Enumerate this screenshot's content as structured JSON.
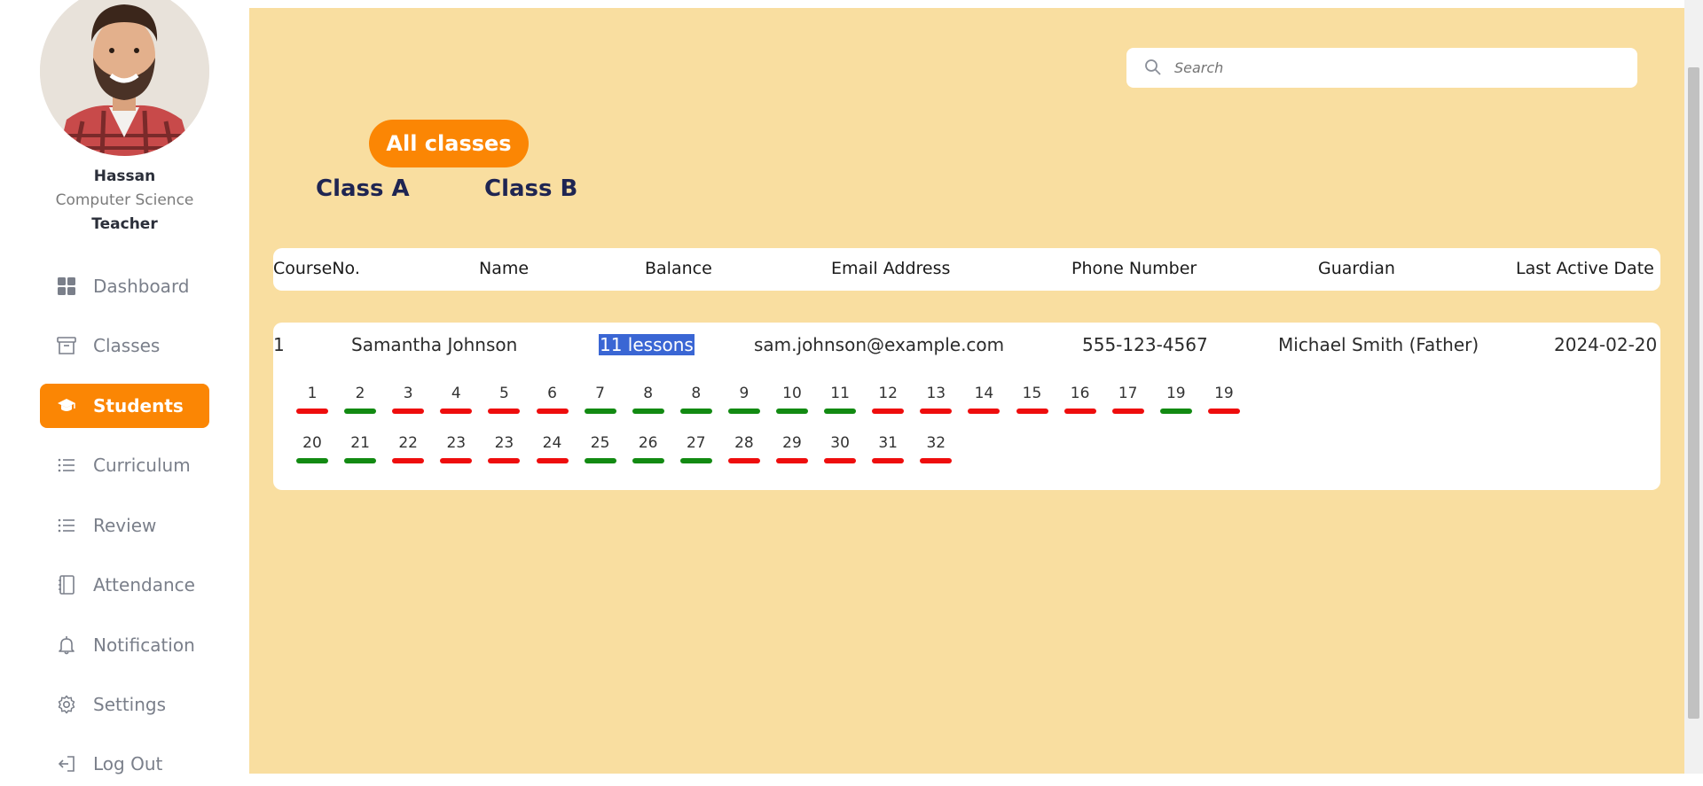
{
  "profile": {
    "name": "Hassan",
    "department": "Computer Science",
    "role": "Teacher"
  },
  "nav": [
    {
      "label": "Dashboard",
      "icon": "dashboard-icon",
      "active": false
    },
    {
      "label": "Classes",
      "icon": "archive-icon",
      "active": false
    },
    {
      "label": "Students",
      "icon": "graduation-cap-icon",
      "active": true
    },
    {
      "label": "Curriculum",
      "icon": "list-icon",
      "active": false
    },
    {
      "label": "Review",
      "icon": "list-icon",
      "active": false
    },
    {
      "label": "Attendance",
      "icon": "notebook-icon",
      "active": false
    },
    {
      "label": "Notification",
      "icon": "bell-icon",
      "active": false
    },
    {
      "label": "Settings",
      "icon": "gear-icon",
      "active": false
    },
    {
      "label": "Log Out",
      "icon": "logout-icon",
      "active": false
    }
  ],
  "search": {
    "placeholder": "Search"
  },
  "filters": {
    "all": "All classes",
    "class_a": "Class A",
    "class_b": "Class B"
  },
  "table": {
    "headers": [
      "CourseNo.",
      "Name",
      "Balance",
      "Email Address",
      "Phone Number",
      "Guardian",
      "Last Active Date"
    ],
    "row": {
      "course_no": "1",
      "name": "Samantha Johnson",
      "balance": "11 lessons",
      "email": "sam.johnson@example.com",
      "phone": "555-123-4567",
      "guardian": "Michael Smith (Father)",
      "last_active": "2024-02-20"
    },
    "lessons": [
      {
        "n": "1",
        "status": "absent"
      },
      {
        "n": "2",
        "status": "present"
      },
      {
        "n": "3",
        "status": "absent"
      },
      {
        "n": "4",
        "status": "absent"
      },
      {
        "n": "5",
        "status": "absent"
      },
      {
        "n": "6",
        "status": "absent"
      },
      {
        "n": "7",
        "status": "present"
      },
      {
        "n": "8",
        "status": "present"
      },
      {
        "n": "8",
        "status": "present"
      },
      {
        "n": "9",
        "status": "present"
      },
      {
        "n": "10",
        "status": "present"
      },
      {
        "n": "11",
        "status": "present"
      },
      {
        "n": "12",
        "status": "absent"
      },
      {
        "n": "13",
        "status": "absent"
      },
      {
        "n": "14",
        "status": "absent"
      },
      {
        "n": "15",
        "status": "absent"
      },
      {
        "n": "16",
        "status": "absent"
      },
      {
        "n": "17",
        "status": "absent"
      },
      {
        "n": "19",
        "status": "present"
      },
      {
        "n": "19",
        "status": "absent"
      },
      {
        "n": "20",
        "status": "present"
      },
      {
        "n": "21",
        "status": "present"
      },
      {
        "n": "22",
        "status": "absent"
      },
      {
        "n": "23",
        "status": "absent"
      },
      {
        "n": "23",
        "status": "absent"
      },
      {
        "n": "24",
        "status": "absent"
      },
      {
        "n": "25",
        "status": "present"
      },
      {
        "n": "26",
        "status": "present"
      },
      {
        "n": "27",
        "status": "present"
      },
      {
        "n": "28",
        "status": "absent"
      },
      {
        "n": "29",
        "status": "absent"
      },
      {
        "n": "30",
        "status": "absent"
      },
      {
        "n": "31",
        "status": "absent"
      },
      {
        "n": "32",
        "status": "absent"
      }
    ]
  },
  "colors": {
    "accent": "#fb8604",
    "main_bg": "#f9dea0",
    "present": "#128a12",
    "absent": "#ee0d0d",
    "heading": "#1f2552",
    "highlight": "#3a66d4"
  }
}
